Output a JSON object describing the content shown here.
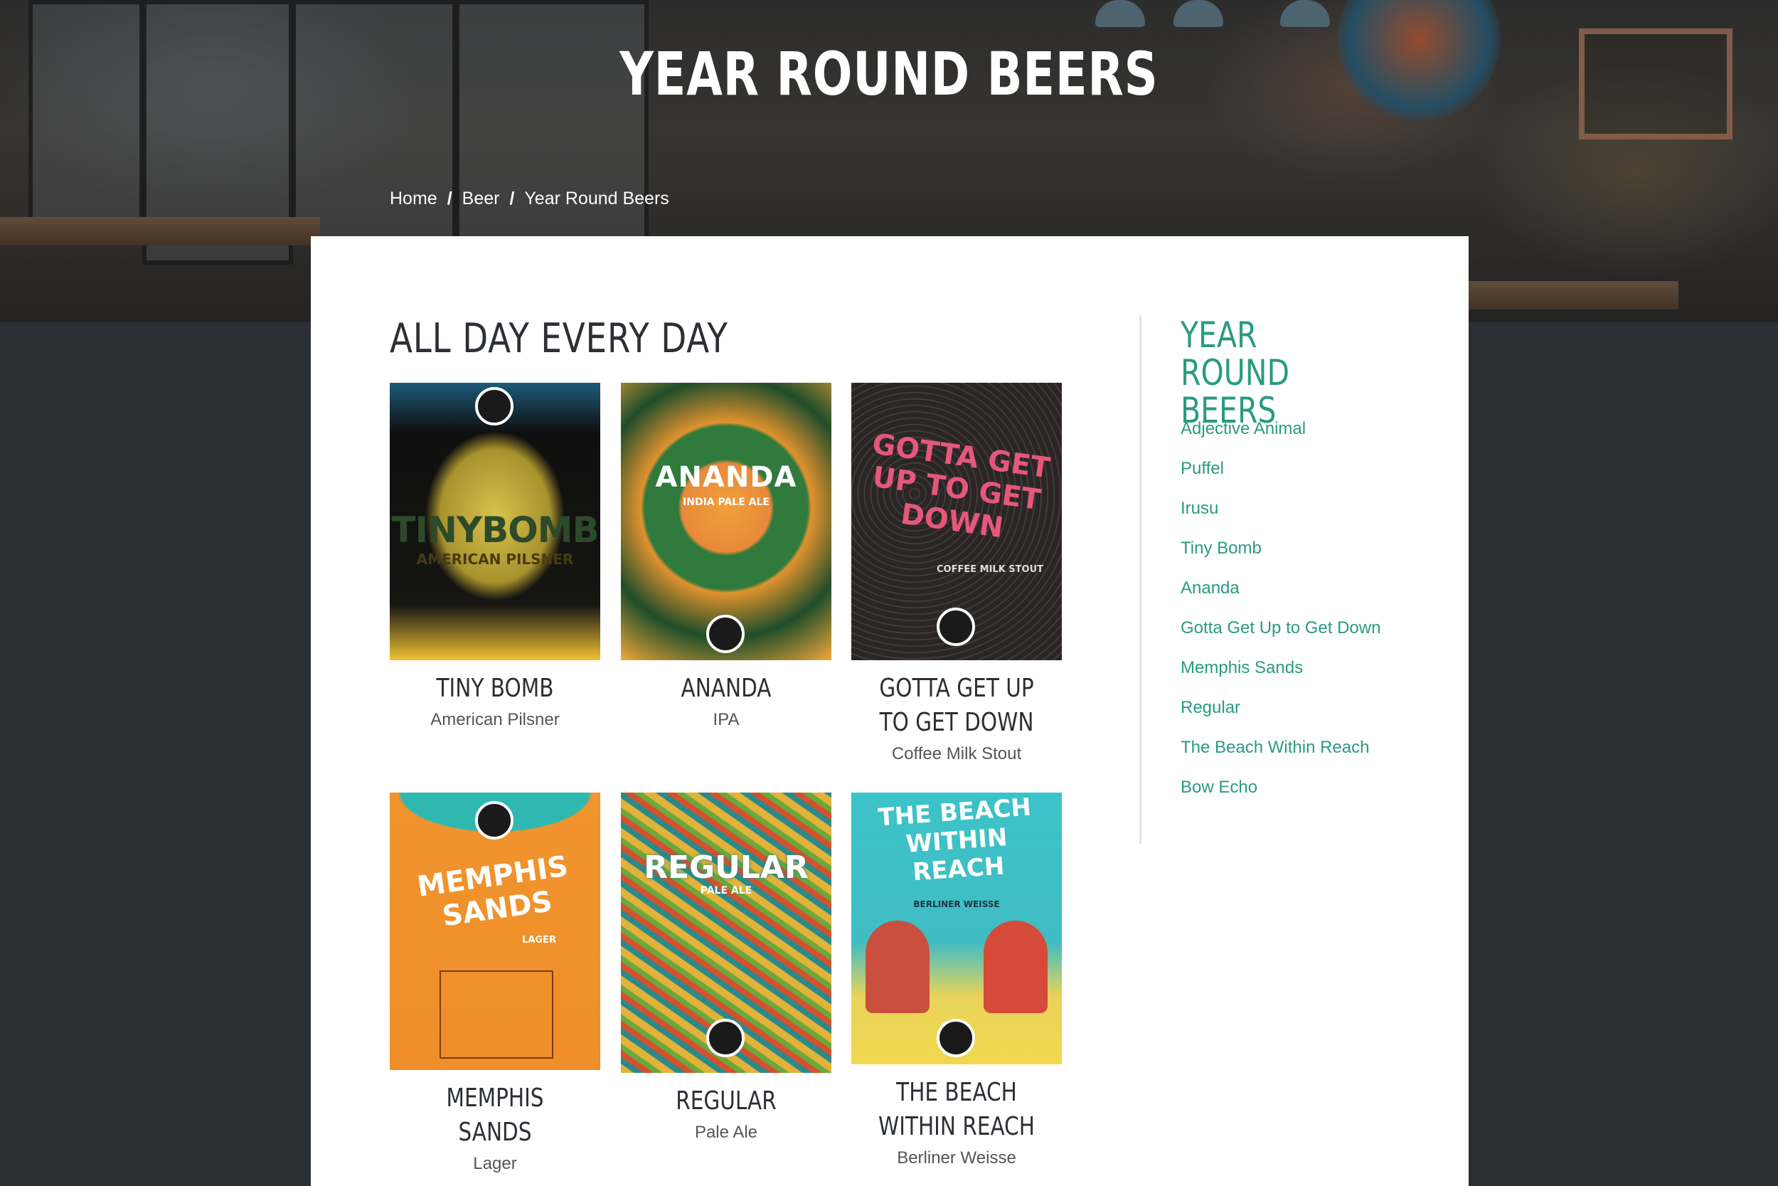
{
  "hero": {
    "title": "YEAR ROUND BEERS"
  },
  "breadcrumb": {
    "items": [
      "Home",
      "Beer",
      "Year Round Beers"
    ],
    "separator": "/"
  },
  "section": {
    "title": "ALL DAY EVERY DAY"
  },
  "beers": [
    {
      "name": "TINY BOMB",
      "style": "American Pilsner",
      "poster_text": "TINYBOMB",
      "poster_sub": "AMERICAN PILSNER"
    },
    {
      "name": "ANANDA",
      "style": "IPA",
      "poster_text": "ANANDA",
      "poster_sub": "INDIA PALE ALE"
    },
    {
      "name": "GOTTA GET UP TO GET DOWN",
      "style": "Coffee Milk Stout",
      "poster_text": "GOTTA GET UP TO GET DOWN",
      "poster_sub": "COFFEE MILK STOUT"
    },
    {
      "name": "MEMPHIS SANDS",
      "style": "Lager",
      "poster_text": "MEMPHIS SANDS",
      "poster_sub": "LAGER"
    },
    {
      "name": "REGULAR",
      "style": "Pale Ale",
      "poster_text": "REGULAR",
      "poster_sub": "PALE ALE"
    },
    {
      "name": "THE BEACH WITHIN REACH",
      "style": "Berliner Weisse",
      "poster_text": "THE BEACH WITHIN REACH",
      "poster_sub": "BERLINER WEISSE"
    }
  ],
  "sidebar": {
    "title": "YEAR ROUND BEERS",
    "links": [
      "Adjective Animal",
      "Puffel",
      "Irusu",
      "Tiny Bomb",
      "Ananda",
      "Gotta Get Up to Get Down",
      "Memphis Sands",
      "Regular",
      "The Beach Within Reach",
      "Bow Echo"
    ]
  },
  "colors": {
    "accent": "#2a9a82",
    "page_bg": "#2c3036",
    "text_dark": "#2c2f33"
  }
}
